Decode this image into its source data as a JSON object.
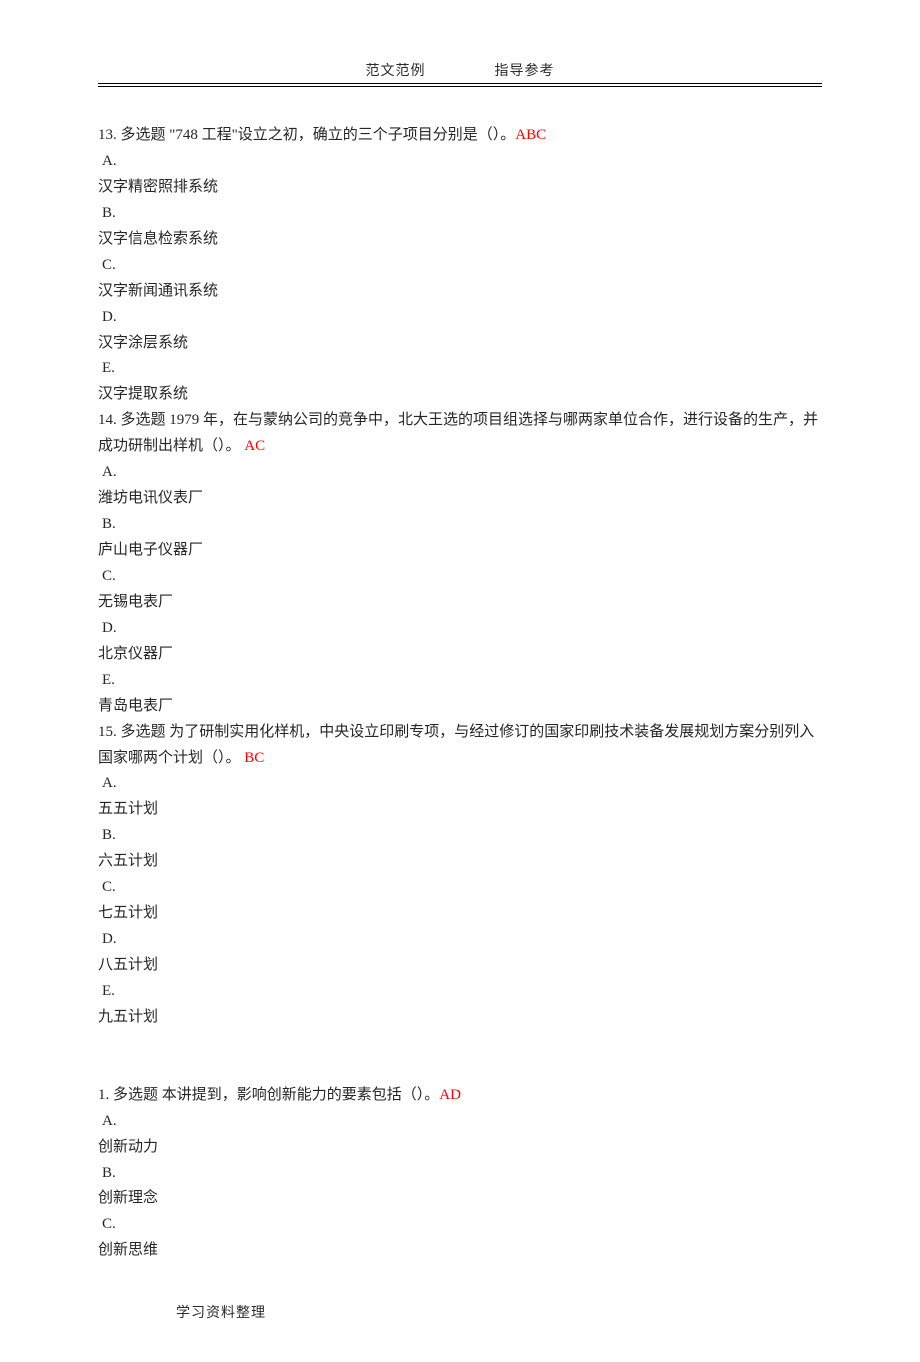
{
  "header": {
    "left": "范文范例",
    "right": "指导参考"
  },
  "footer": "学习资料整理",
  "questions": [
    {
      "num": "13.",
      "type": "多选题",
      "stem_before": " \"748 工程\"设立之初，确立的三个子项目分别是（）。",
      "answer": "ABC",
      "stem_after": "",
      "options": [
        {
          "label": "A.",
          "text": "汉字精密照排系统"
        },
        {
          "label": "B.",
          "text": "汉字信息检索系统"
        },
        {
          "label": "C.",
          "text": "汉字新闻通讯系统"
        },
        {
          "label": "D.",
          "text": "汉字涂层系统"
        },
        {
          "label": "E.",
          "text": "汉字提取系统"
        }
      ]
    },
    {
      "num": "14.",
      "type": "多选题",
      "stem_before": " 1979 年，在与蒙纳公司的竞争中，北大王选的项目组选择与哪两家单位合作，进行设备的生产，并成功研制出样机（）。  ",
      "answer": "AC",
      "stem_after": "",
      "options": [
        {
          "label": "A.",
          "text": "潍坊电讯仪表厂"
        },
        {
          "label": "B.",
          "text": "庐山电子仪器厂"
        },
        {
          "label": "C.",
          "text": "无锡电表厂"
        },
        {
          "label": "D.",
          "text": "北京仪器厂"
        },
        {
          "label": "E.",
          "text": "青岛电表厂"
        }
      ]
    },
    {
      "num": "15.",
      "type": "多选题",
      "stem_before": " 为了研制实用化样机，中央设立印刷专项，与经过修订的国家印刷技术装备发展规划方案分别列入国家哪两个计划（）。  ",
      "answer": "BC",
      "stem_after": "",
      "options": [
        {
          "label": "A.",
          "text": "五五计划"
        },
        {
          "label": "B.",
          "text": "六五计划"
        },
        {
          "label": "C.",
          "text": "七五计划"
        },
        {
          "label": "D.",
          "text": " 八五计划"
        },
        {
          "label": "E.",
          "text": "九五计划"
        }
      ]
    },
    {
      "num": "1.",
      "type": "多选题",
      "stem_before": " 本讲提到，影响创新能力的要素包括（）。",
      "answer": "AD",
      "stem_after": "",
      "options": [
        {
          "label": "A.",
          "text": "创新动力"
        },
        {
          "label": "B.",
          "text": "创新理念"
        },
        {
          "label": "C.",
          "text": "创新思维"
        }
      ]
    }
  ]
}
